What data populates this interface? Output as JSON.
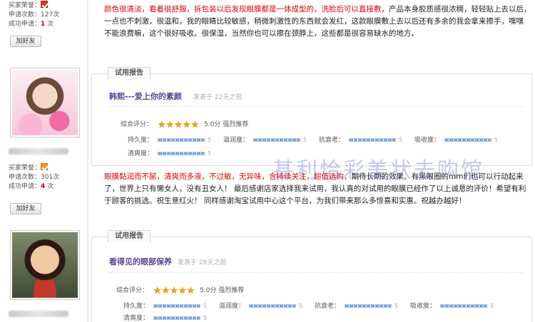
{
  "colors": {
    "highlight_red": "#e2000b",
    "title_purple": "#5b4399",
    "star_gold": "#f5a400",
    "bar_blue": "#7aa6dc"
  },
  "users": [
    {
      "honor_label": "买家荣誉：",
      "apply_label": "申请次数：",
      "apply_count": "127次",
      "success_label": "成功申请：",
      "success_count": "1",
      "success_suffix": "次",
      "add_friend": "加好友"
    },
    {
      "honor_label": "买家荣誉：",
      "apply_label": "申请次数：",
      "apply_count": "301次",
      "success_label": "成功申请：",
      "success_count": "4",
      "success_suffix": "次",
      "add_friend": "加好友"
    }
  ],
  "review1": {
    "hl": "颜色很清淡，看着很舒服，拆包装以后发现眼膜都是一体成型的，洗脸后可以直接敷，",
    "text": "产品本身胶质感很浓稠，轻轻贴上去以后，一点也不刺激，很温和，我的眼睛比较敏感，稍微刺激性的东西就会发红，这款眼膜敷上去以后还有多余的我会拿来擦手，嘿嘿 不能浪费嘛，这个很好吸收。很保湿，当然你也可以擦在颈脖上，这些都是很容易缺水的地方。"
  },
  "report_tab": "试用报告",
  "reports": [
    {
      "title": "韩熙---爱上你的素颜",
      "date": "发表于 22天之前",
      "score_label": "综合评分：",
      "score": "5.0分",
      "recommend": "强烈推荐",
      "metrics": [
        {
          "label": "持久度：",
          "value": "5"
        },
        {
          "label": "滋润度：",
          "value": "5"
        },
        {
          "label": "抗衰老：",
          "value": "5"
        },
        {
          "label": "吸收度：",
          "value": "5"
        },
        {
          "label": "清爽度：",
          "value": "5"
        }
      ]
    },
    {
      "title": "看得见的眼部保养",
      "date": "发表于 28天之前",
      "score_label": "综合评分：",
      "score": "5.0分",
      "recommend": "强烈推荐",
      "metrics": [
        {
          "label": "持久度：",
          "value": "5"
        },
        {
          "label": "滋润度：",
          "value": "5"
        },
        {
          "label": "抗衰老：",
          "value": "5"
        },
        {
          "label": "吸收度：",
          "value": "5"
        },
        {
          "label": "清爽度：",
          "value": "5"
        }
      ]
    }
  ],
  "review2": {
    "hl": "眼膜黏润而不腻，清爽而多液，不过敏，无异味，含持续关注，超值选购，",
    "text": "期待长期的效果。有黑眼圈的mm们也可以行动起来了，世界上只有懒女人，没有丑女人！ 最后感谢店家选择我来试用，我认真的对试用的眼膜已经作了以上诚恳的评价！希望有利于顾客的挑选。祝生意红火！ 同样感谢淘宝试用中心这个平台，为我们带来那么多惊喜和实惠。祝越办越好！"
  },
  "watermark": "甚利恰彩美状去购馆"
}
